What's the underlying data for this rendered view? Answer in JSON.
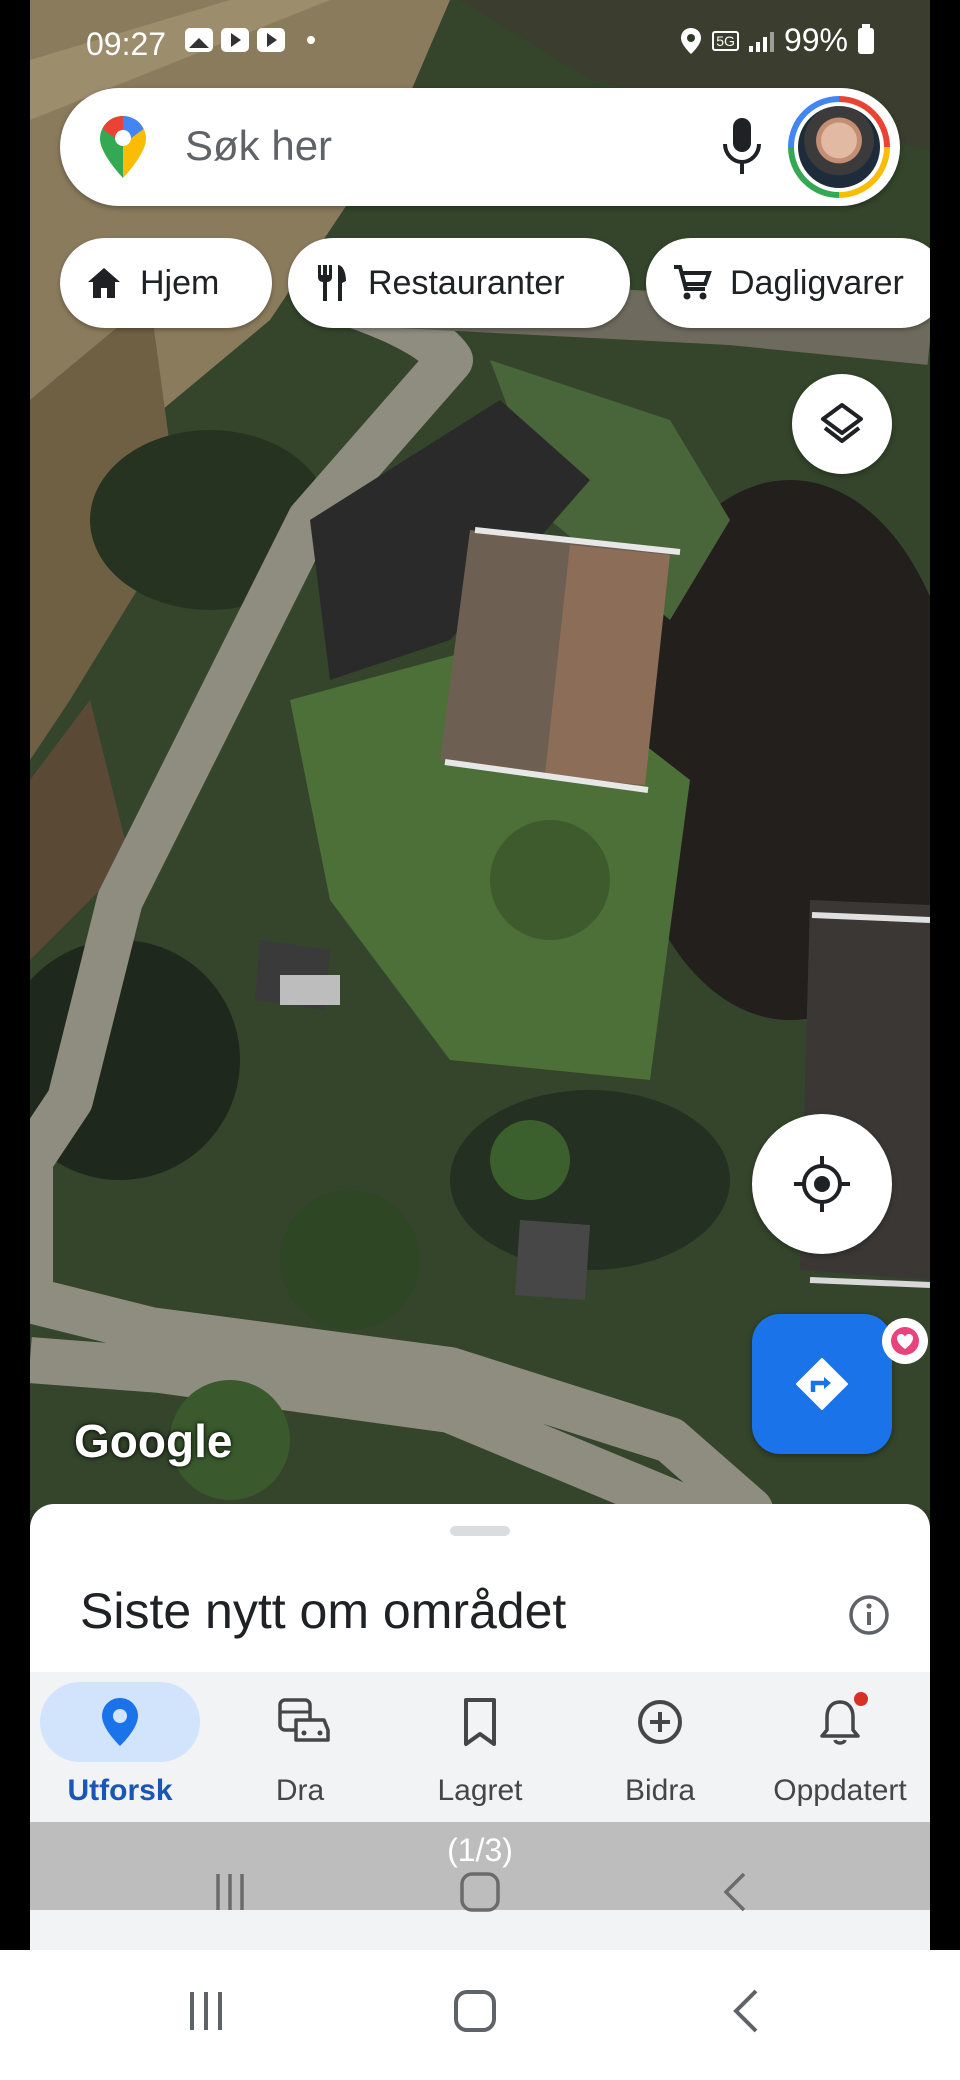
{
  "status_bar": {
    "time": "09:27",
    "network": "5G",
    "battery": "99%",
    "icons": [
      "gallery-icon",
      "youtube-icon",
      "youtube-icon",
      "location-icon",
      "signal-icon",
      "battery-icon"
    ]
  },
  "search": {
    "placeholder": "Søk her",
    "icons": [
      "google-maps-pin-icon",
      "microphone-icon",
      "profile-avatar"
    ]
  },
  "chips": [
    {
      "label": "Hjem",
      "icon": "home-icon"
    },
    {
      "label": "Restauranter",
      "icon": "restaurant-icon"
    },
    {
      "label": "Dagligvarer",
      "icon": "cart-icon"
    }
  ],
  "map": {
    "attribution": "Google",
    "controls": [
      "layers-icon",
      "my-location-icon",
      "directions-icon"
    ]
  },
  "sheet": {
    "title": "Siste nytt om området",
    "icon": "info-icon"
  },
  "nav": {
    "items": [
      {
        "label": "Utforsk",
        "icon": "pin-icon",
        "active": true
      },
      {
        "label": "Dra",
        "icon": "commute-icon",
        "active": false
      },
      {
        "label": "Lagret",
        "icon": "bookmark-icon",
        "active": false
      },
      {
        "label": "Bidra",
        "icon": "add-circle-icon",
        "active": false
      },
      {
        "label": "Oppdatert",
        "icon": "bell-icon",
        "active": false
      }
    ]
  },
  "overlay": {
    "counter": "(1/3)"
  },
  "colors": {
    "accent_blue": "#1a73e8",
    "active_pill": "#d2e3fc",
    "notification_red": "#d93025"
  }
}
